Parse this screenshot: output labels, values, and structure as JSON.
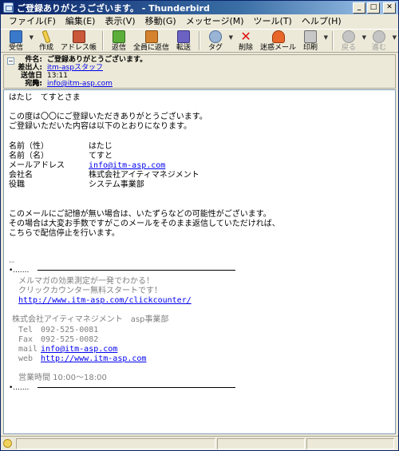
{
  "window": {
    "title": "ご登録ありがとうございます。 - Thunderbird"
  },
  "menu": [
    "ファイル(F)",
    "編集(E)",
    "表示(V)",
    "移動(G)",
    "メッセージ(M)",
    "ツール(T)",
    "ヘルプ(H)"
  ],
  "toolbar": {
    "get_mail": "受信",
    "compose": "作成",
    "address_book": "アドレス帳",
    "reply": "返信",
    "reply_all": "全員に返信",
    "forward": "転送",
    "tag": "タグ",
    "delete": "削除",
    "junk": "迷惑メール",
    "print": "印刷",
    "back": "戻る",
    "forward_nav": "進む"
  },
  "header": {
    "subject_label": "件名:",
    "subject": "ご登録ありがとうございます。",
    "from_label": "差出人:",
    "from": "itm-aspスタッフ",
    "date_label": "送信日時:",
    "date": "13:11",
    "to_label": "宛先:",
    "to": "info@itm-asp.com"
  },
  "body": {
    "greeting": "はたじ　てすとさま",
    "intro1": "この度は〇〇にご登録いただきありがとうございます。",
    "intro2": "ご登録いただいた内容は以下のとおりになります。",
    "fields": [
      {
        "label": "名前（性）",
        "value": "はたじ"
      },
      {
        "label": "名前（名）",
        "value": "てすと"
      },
      {
        "label": "メールアドレス",
        "value": "info@itm-asp.com"
      },
      {
        "label": "会社名",
        "value": "株式会社アイティマネジメント"
      },
      {
        "label": "役職",
        "value": "システム事業部"
      }
    ],
    "note1": "このメールにご記憶が無い場合は、いたずらなどの可能性がございます。",
    "note2": "その場合は大変お手数ですがこのメールをそのまま返信していただければ、",
    "note3": "こちらで配信停止を行います。",
    "sig_dash": "--",
    "sig_dots": "•.......",
    "promo1": "メルマガの効果測定が一発でわかる！",
    "promo2": "クリックカウンター無料スタートです！",
    "promo_url": "http://www.itm-asp.com/clickcounter/",
    "company": "株式会社アイティマネジメント　asp事業部",
    "tel": "Tel　092-525-0081",
    "fax": "Fax　092-525-0082",
    "mail_label": "mail",
    "mail": "info@itm-asp.com",
    "web_label": "web",
    "web": "http://www.itm-asp.com",
    "hours": "営業時間 10:00～18:00"
  }
}
